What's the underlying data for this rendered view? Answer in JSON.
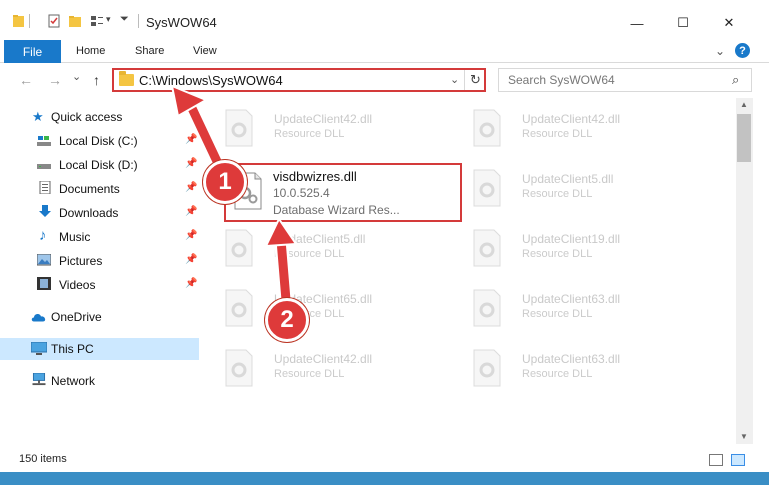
{
  "window": {
    "title": "SysWOW64",
    "minimize_glyph": "—",
    "maximize_glyph": "☐",
    "close_glyph": "✕"
  },
  "ribbon": {
    "file_tab": "File",
    "tabs": [
      "Home",
      "Share",
      "View"
    ],
    "collapse_glyph": "⌄",
    "help_glyph": "?"
  },
  "nav": {
    "back_glyph": "←",
    "forward_glyph": "→",
    "recent_glyph": "⌄",
    "up_glyph": "↑",
    "address": "C:\\Windows\\SysWOW64",
    "address_dropdown_glyph": "⌄",
    "refresh_glyph": "↻",
    "search_placeholder": "Search SysWOW64",
    "search_glyph": "⌕"
  },
  "sidebar": {
    "pin_glyph": "📌",
    "quick_access": "Quick access",
    "items": [
      {
        "label": "Local Disk (C:)",
        "pinned": true
      },
      {
        "label": "Local Disk (D:)",
        "pinned": true
      },
      {
        "label": "Documents",
        "pinned": true
      },
      {
        "label": "Downloads",
        "pinned": true
      },
      {
        "label": "Music",
        "pinned": true
      },
      {
        "label": "Pictures",
        "pinned": true
      },
      {
        "label": "Videos",
        "pinned": true
      }
    ],
    "onedrive": "OneDrive",
    "this_pc": "This PC",
    "network": "Network"
  },
  "files": [
    {
      "name": "UpdateClient42.dll",
      "type": "Resource DLL"
    },
    {
      "name": "UpdateClient42.dll",
      "type": "Resource DLL"
    },
    {
      "name": "UpdateClient5.dll",
      "type": "Resource DLL"
    },
    {
      "name": "UpdateClient5.dll",
      "type": "Resource DLL"
    },
    {
      "name": "UpdateClient19.dll",
      "type": "Resource DLL"
    },
    {
      "name": "UpdateClient65.dll",
      "type": "Resource DLL"
    },
    {
      "name": "UpdateClient63.dll",
      "type": "Resource DLL"
    },
    {
      "name": "UpdateClient42.dll",
      "type": "Resource DLL"
    },
    {
      "name": "UpdateClient63.dll",
      "type": "Resource DLL"
    }
  ],
  "highlighted_file": {
    "name": "visdbwizres.dll",
    "version": "10.0.525.4",
    "description": "Database Wizard Res..."
  },
  "status": {
    "item_count": "150 items"
  },
  "annotations": {
    "badge_1": "1",
    "badge_2": "2",
    "color": "#de3a3a"
  }
}
